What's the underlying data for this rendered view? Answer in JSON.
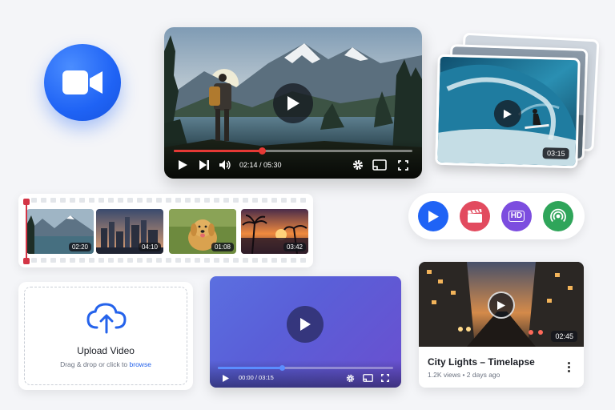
{
  "app_icon": {
    "icon": "video-camera-icon",
    "color": "#1f63f5"
  },
  "main_player": {
    "time_current": "02:14",
    "time_total": "05:30",
    "time_display": "02:14 / 05:30",
    "progress": 0.37,
    "accent": "#e53935"
  },
  "surf_card": {
    "duration": "03:15"
  },
  "filmstrip": {
    "thumbs": [
      {
        "name": "mountain-lake",
        "duration": "02:20"
      },
      {
        "name": "city-skyline",
        "duration": "04:10"
      },
      {
        "name": "golden-retriever",
        "duration": "01:08"
      },
      {
        "name": "tropical-sunset",
        "duration": "03:42"
      }
    ]
  },
  "tray": {
    "icons": [
      {
        "name": "play-icon",
        "color": "#1f63f5"
      },
      {
        "name": "clapperboard-icon",
        "color": "#e24b5f"
      },
      {
        "name": "hd-icon",
        "color": "#7c4ddf",
        "label": "HD"
      },
      {
        "name": "broadcast-icon",
        "color": "#2fa55a"
      }
    ]
  },
  "upload": {
    "title": "Upload Video",
    "hint_prefix": "Drag & drop or click to ",
    "hint_link": "browse"
  },
  "purple_player": {
    "time_display": "00:00 / 03:15",
    "progress": 0.37
  },
  "city_card": {
    "duration": "02:45",
    "title": "City Lights – Timelapse",
    "meta": "1.2K views • 2 days ago"
  }
}
